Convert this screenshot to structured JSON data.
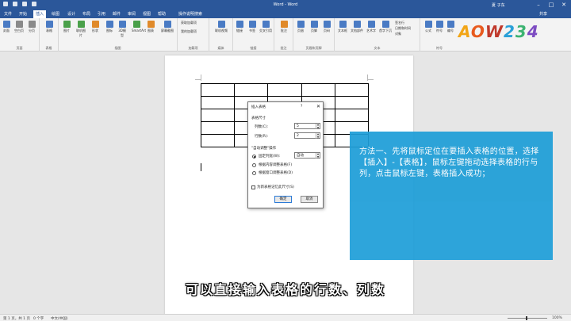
{
  "window": {
    "title": "Word - Word",
    "user": "夏 子东",
    "share": "共享"
  },
  "tabs": [
    "文件",
    "开始",
    "插入",
    "绘图",
    "设计",
    "布局",
    "引用",
    "邮件",
    "审阅",
    "视图",
    "帮助"
  ],
  "tell_me": "操作说明搜索",
  "ribbon": {
    "groups": [
      {
        "label": "页面",
        "buttons": [
          "封面",
          "空白页",
          "分页"
        ]
      },
      {
        "label": "表格",
        "buttons": [
          "表格"
        ]
      },
      {
        "label": "插图",
        "buttons": [
          "图片",
          "联机图片",
          "形状",
          "图标",
          "3D模型",
          "SmartArt",
          "图表",
          "屏幕截图"
        ]
      },
      {
        "label": "加载项",
        "buttons": [
          "获取加载项",
          "我的加载项"
        ]
      },
      {
        "label": "媒体",
        "buttons": [
          "联机视频"
        ]
      },
      {
        "label": "链接",
        "buttons": [
          "链接",
          "书签",
          "交叉引用"
        ]
      },
      {
        "label": "批注",
        "buttons": [
          "批注"
        ]
      },
      {
        "label": "页眉和页脚",
        "buttons": [
          "页眉",
          "页脚",
          "页码"
        ]
      },
      {
        "label": "文本",
        "buttons": [
          "文本框",
          "文档部件",
          "艺术字",
          "首字下沉",
          "签名行",
          "日期和时间",
          "对象"
        ]
      },
      {
        "label": "符号",
        "buttons": [
          "公式",
          "符号",
          "编号"
        ]
      }
    ]
  },
  "logo": [
    "A",
    "O",
    "W",
    "2",
    "3",
    "4"
  ],
  "dialog": {
    "title": "插入表格",
    "help": "?",
    "close": "✕",
    "section_size": "表格尺寸",
    "columns_label": "列数(C):",
    "columns_value": "5",
    "rows_label": "行数(R):",
    "rows_value": "2",
    "section_autofit": "\"自动调整\"操作",
    "fixed_col_label": "固定列宽(W):",
    "fixed_col_value": "自动",
    "fit_contents": "根据内容调整表格(F)",
    "fit_window": "根据窗口调整表格(D)",
    "remember": "为新表格记忆此尺寸(S)",
    "ok": "确定",
    "cancel": "取消"
  },
  "note": "方法一、先将鼠标定位在要插入表格的位置，选择【插入】-【表格】，鼠标左键拖动选择表格的行与列，点击鼠标左键，表格插入成功；",
  "subtitle": "可以直接输入表格的行数、列数",
  "status": {
    "page": "第 1 页，共 1 页",
    "words": "0 个字",
    "lang": "中文(中国)",
    "zoom": "100%"
  }
}
